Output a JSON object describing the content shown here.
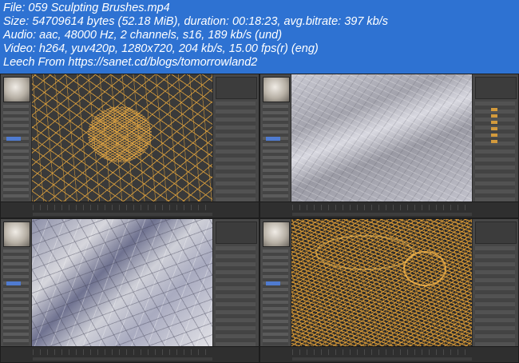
{
  "header": {
    "lines": [
      "File: 059 Sculpting Brushes.mp4",
      "Size: 54709614 bytes (52.18 MiB), duration: 00:18:23, avg.bitrate: 397 kb/s",
      "Audio: aac, 48000 Hz, 2 channels, s16, 189 kb/s (und)",
      "Video: h264, yuv420p, 1280x720, 204 kb/s, 15.00 fps(r) (eng)",
      "Leech From https://sanet.cd/blogs/tomorrowland2"
    ]
  },
  "colors": {
    "header_bg": "#2e72d2",
    "wire": "#dca03c",
    "panel": "#4a4a4a"
  }
}
